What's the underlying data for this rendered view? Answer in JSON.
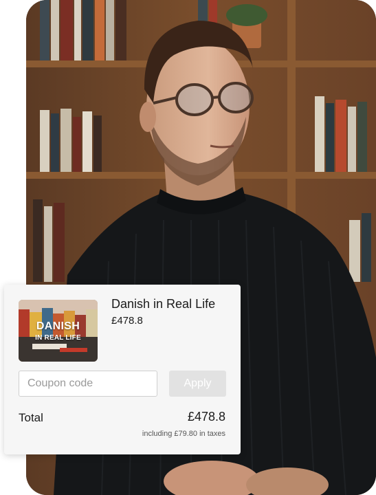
{
  "product": {
    "name": "Danish in Real Life",
    "price": "£478.8",
    "thumbnail_line1": "DANISH",
    "thumbnail_line2": "IN REAL LIFE"
  },
  "coupon": {
    "placeholder": "Coupon code",
    "value": "",
    "apply_label": "Apply"
  },
  "summary": {
    "total_label": "Total",
    "total_amount": "£478.8",
    "tax_note": "including £79.80 in taxes"
  },
  "colors": {
    "card_background": "#f6f6f6",
    "apply_button_disabled": "#e2e2e2",
    "text_primary": "#1a1a1a"
  }
}
